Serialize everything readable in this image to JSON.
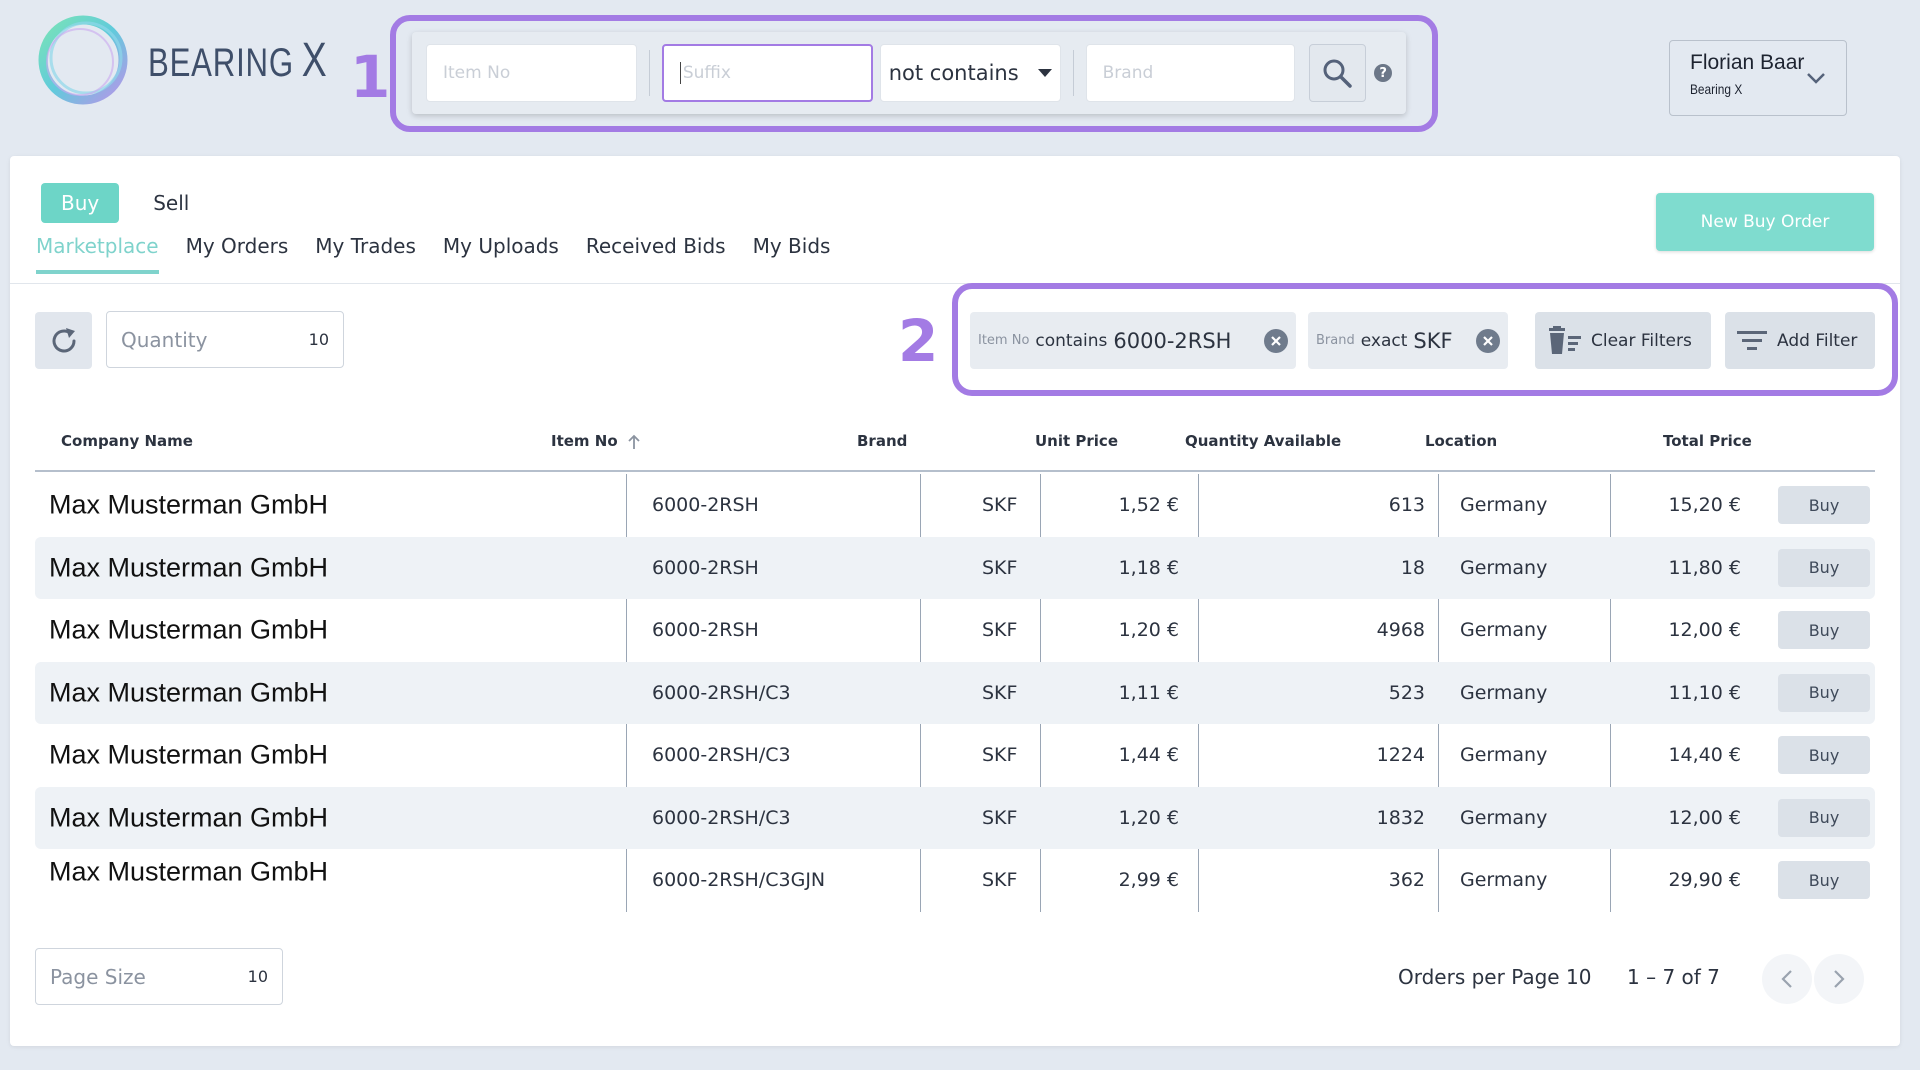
{
  "brand": {
    "name": "BEARING",
    "mark": "X"
  },
  "annotations": {
    "marker_1": "1",
    "marker_2": "2"
  },
  "search": {
    "item_placeholder": "Item No",
    "suffix_placeholder": "Suffix",
    "operator": "not contains",
    "brand_placeholder": "Brand"
  },
  "user": {
    "name": "Florian Baar",
    "company": "Bearing X"
  },
  "mode": {
    "buy": "Buy",
    "sell": "Sell"
  },
  "new_order_label": "New Buy Order",
  "tabs": [
    "Marketplace",
    "My Orders",
    "My Trades",
    "My Uploads",
    "Received Bids",
    "My Bids"
  ],
  "quantity": {
    "label": "Quantity",
    "value": "10"
  },
  "filters": [
    {
      "field": "Item No",
      "operator": "contains",
      "value": "6000-2RSH"
    },
    {
      "field": "Brand",
      "operator": "exact",
      "value": "SKF"
    }
  ],
  "actions": {
    "clear": "Clear Filters",
    "add": "Add Filter"
  },
  "table": {
    "columns": [
      "Company Name",
      "Item No",
      "Brand",
      "Unit Price",
      "Quantity Available",
      "Location",
      "Total Price"
    ],
    "buy_label": "Buy",
    "rows": [
      [
        "Max Musterman GmbH",
        "6000-2RSH",
        "SKF",
        "1,52 €",
        "613",
        "Germany",
        "15,20 €"
      ],
      [
        "Max Musterman GmbH",
        "6000-2RSH",
        "SKF",
        "1,18 €",
        "18",
        "Germany",
        "11,80 €"
      ],
      [
        "Max Musterman GmbH",
        "6000-2RSH",
        "SKF",
        "1,20 €",
        "4968",
        "Germany",
        "12,00 €"
      ],
      [
        "Max Musterman GmbH",
        "6000-2RSH/C3",
        "SKF",
        "1,11 €",
        "523",
        "Germany",
        "11,10 €"
      ],
      [
        "Max Musterman GmbH",
        "6000-2RSH/C3",
        "SKF",
        "1,44 €",
        "1224",
        "Germany",
        "14,40 €"
      ],
      [
        "Max Musterman GmbH",
        "6000-2RSH/C3",
        "SKF",
        "1,20 €",
        "1832",
        "Germany",
        "12,00 €"
      ],
      [
        "Max Musterman GmbH",
        "6000-2RSH/C3GJN",
        "SKF",
        "2,99 €",
        "362",
        "Germany",
        "29,90 €"
      ]
    ]
  },
  "footer": {
    "page_size_label": "Page Size",
    "page_size_value": "10",
    "orders_per_page": "Orders per Page 10",
    "range": "1 – 7 of 7"
  },
  "colors": {
    "accent": "#7fd3cc",
    "highlight": "#a37be4"
  }
}
